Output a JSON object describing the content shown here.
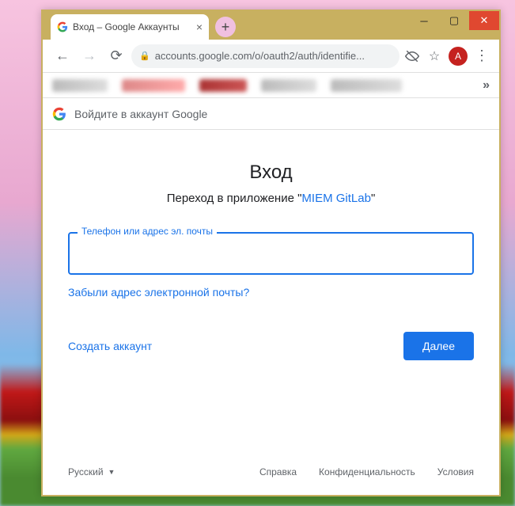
{
  "window": {
    "avatar_letter": "A"
  },
  "tab": {
    "title": "Вход – Google Аккаунты"
  },
  "address": {
    "url": "accounts.google.com/o/oauth2/auth/identifie..."
  },
  "header": {
    "text": "Войдите в аккаунт Google"
  },
  "signin": {
    "title": "Вход",
    "subtitle_prefix": "Переход в приложение \"",
    "app_name": "MIEM GitLab",
    "subtitle_suffix": "\"",
    "field_label": "Телефон или адрес эл. почты",
    "forgot": "Забыли адрес электронной почты?",
    "create": "Создать аккаунт",
    "next": "Далее"
  },
  "footer": {
    "language": "Русский",
    "help": "Справка",
    "privacy": "Конфиденциальность",
    "terms": "Условия"
  }
}
